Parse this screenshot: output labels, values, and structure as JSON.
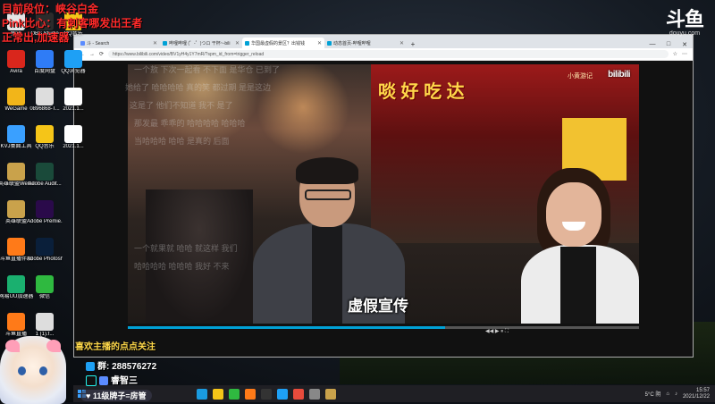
{
  "stream_overlay": {
    "top_left_lines": [
      "目前段位：峡谷白金",
      "Pink比心：有刺客哪发出王者",
      "正常出,加速器"
    ],
    "follow_text": "喜欢主播的点点关注",
    "group_text": "群: 288576272",
    "douyin_text": "睿智三",
    "fan_badge_text": "11级牌子=房管"
  },
  "douyu_logo": {
    "text": "斗鱼",
    "sub": "douyu.com"
  },
  "desktop_icons": [
    {
      "label": "腾讯",
      "icon": "app-icon",
      "color": "#e5e5e5"
    },
    {
      "label": "OBS Studio",
      "icon": "obs-icon",
      "color": "#2b2b2b"
    },
    {
      "label": "QQ音乐",
      "icon": "qq-music-icon",
      "color": "#f5c518"
    },
    {
      "label": "Avira",
      "icon": "avira-icon",
      "color": "#d9261c"
    },
    {
      "label": "百度网盘",
      "icon": "baidu-pan-icon",
      "color": "#2f7cf6"
    },
    {
      "label": "QQ浏览器",
      "icon": "qq-browser-icon",
      "color": "#1ea0f5"
    },
    {
      "label": "WeGame",
      "icon": "wegame-icon",
      "color": "#f2b519"
    },
    {
      "label": "0896868-T...",
      "icon": "file-icon",
      "color": "#dddddd"
    },
    {
      "label": "2021.1...",
      "icon": "file-icon",
      "color": "#ffffff"
    },
    {
      "label": "KVJ桌面工具",
      "icon": "tool-icon",
      "color": "#3aa0ff"
    },
    {
      "label": "QQ音乐",
      "icon": "qq-music-icon",
      "color": "#f5c518"
    },
    {
      "label": "2021.1...",
      "icon": "file-icon",
      "color": "#ffffff"
    },
    {
      "label": "英雄联盟WeGame版",
      "icon": "lol-icon",
      "color": "#c9a24b"
    },
    {
      "label": "Adobe Audit...",
      "icon": "audition-icon",
      "color": "#1a4a3a"
    },
    {
      "label": "英雄联盟",
      "icon": "lol-icon",
      "color": "#c9a24b"
    },
    {
      "label": "Adobe Premie...",
      "icon": "premiere-icon",
      "color": "#2a0a4a"
    },
    {
      "label": "斗鱼直播伴侣",
      "icon": "douyu-icon",
      "color": "#ff7a18"
    },
    {
      "label": "Adobe Photosh...",
      "icon": "photoshop-icon",
      "color": "#0a1f3a"
    },
    {
      "label": "网易UU加速器",
      "icon": "uu-icon",
      "color": "#1ab06f"
    },
    {
      "label": "微信",
      "icon": "wechat-icon",
      "color": "#2fb940"
    },
    {
      "label": "斗鱼直播",
      "icon": "douyu-icon",
      "color": "#ff7a18"
    },
    {
      "label": "1 (1).f...",
      "icon": "file-icon",
      "color": "#dddddd"
    }
  ],
  "browser": {
    "tabs": [
      {
        "label": "斗 - Search",
        "icon_color": "#5b8cff",
        "active": false
      },
      {
        "label": "哔哩哔哩 (゜-゜)つロ 干杯~-bili",
        "icon_color": "#00a1d6",
        "active": false
      },
      {
        "label": "华国最虚假的景区？出钱钱",
        "icon_color": "#00a1d6",
        "active": true
      },
      {
        "label": "动态首页-哔哩哔哩",
        "icon_color": "#00a1d6",
        "active": false
      }
    ],
    "new_tab_label": "+",
    "window_controls": [
      "—",
      "□",
      "✕"
    ],
    "url": "https://www.bilibili.com/video/BV1yH4y1Y7mR/?spm_id_from=trigger_reload",
    "nav": {
      "back": "←",
      "forward": "→",
      "refresh": "⟳"
    }
  },
  "video": {
    "subtitle": "虚假宣传",
    "shop_sign": "啖 好 吃 达",
    "watermark": "bilibili",
    "watermark_sub": "小黄游记",
    "progress": 0.62,
    "controls_text": "◀◀  ▶  ⏸  ⛶"
  },
  "danmaku": [
    "一个敖   下次一起看   不下面   是华仓   已到了",
    "她给了   哈哈哈哈   真的笑   都过期   是是这边",
    "这是了   他们不知道   我不   是了",
    "那发最   乖乖的   哈哈哈哈   哈哈哈",
    "当哈哈哈   哈哈   是真的   后面",
    "一个就果就   哈哈   就这样   我们",
    "哈哈哈哈   哈哈哈   我好   不来"
  ],
  "taskbar": {
    "weather": "5°C 阴",
    "time": "15:57",
    "date": "2021/12/22",
    "apps": [
      {
        "name": "edge-icon",
        "color": "#1a9be0"
      },
      {
        "name": "file-explorer-icon",
        "color": "#f5c518"
      },
      {
        "name": "wechat-icon",
        "color": "#2fb940"
      },
      {
        "name": "douyu-icon",
        "color": "#ff7a18"
      },
      {
        "name": "obs-icon",
        "color": "#333333"
      },
      {
        "name": "qq-icon",
        "color": "#1ea0f5"
      },
      {
        "name": "chrome-icon",
        "color": "#e84b3c"
      },
      {
        "name": "settings-icon",
        "color": "#888888"
      },
      {
        "name": "game-icon",
        "color": "#c9a24b"
      }
    ]
  },
  "colors": {
    "accent": "#00a1d6",
    "overlay_red": "#ff2a2a",
    "follow_yellow": "#ffd94a"
  }
}
